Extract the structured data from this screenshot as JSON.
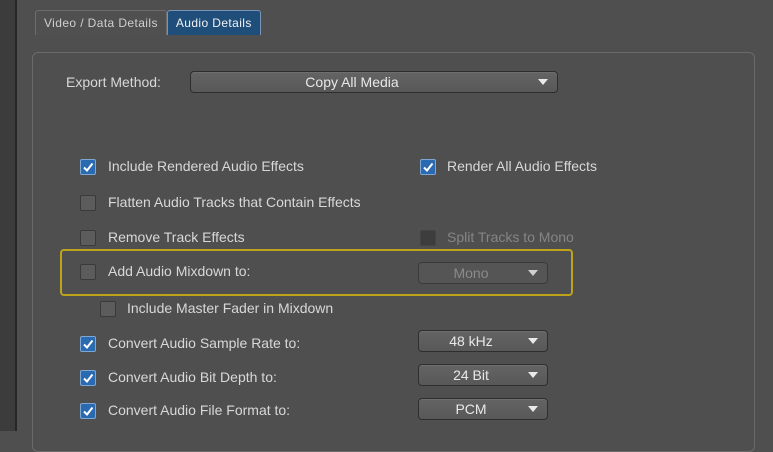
{
  "tabs": [
    {
      "label": "Video / Data Details",
      "active": false
    },
    {
      "label": "Audio Details",
      "active": true
    }
  ],
  "export_method": {
    "label": "Export Method:",
    "value": "Copy All Media"
  },
  "options": {
    "include_rendered_effects": {
      "label": "Include Rendered Audio Effects",
      "checked": true
    },
    "render_all_effects": {
      "label": "Render All Audio Effects",
      "checked": true
    },
    "flatten_tracks": {
      "label": "Flatten Audio Tracks that Contain Effects",
      "checked": false
    },
    "remove_track_effects": {
      "label": "Remove Track Effects",
      "checked": false
    },
    "split_tracks_mono": {
      "label": "Split Tracks to Mono",
      "checked": false,
      "enabled": false
    },
    "add_mixdown": {
      "label": "Add Audio Mixdown to:",
      "checked": false,
      "dropdown_value": "Mono",
      "dropdown_enabled": false
    },
    "include_master_fader": {
      "label": "Include Master Fader in Mixdown",
      "checked": false
    },
    "convert_sample_rate": {
      "label": "Convert Audio Sample Rate to:",
      "checked": true,
      "value": "48 kHz"
    },
    "convert_bit_depth": {
      "label": "Convert Audio Bit Depth to:",
      "checked": true,
      "value": "24 Bit"
    },
    "convert_file_format": {
      "label": "Convert Audio File Format to:",
      "checked": true,
      "value": "PCM"
    }
  },
  "colors": {
    "accent": "#2a6ab0",
    "highlight": "#bfa41b",
    "active_tab": "#1f4e7a",
    "background": "#4f4f4f"
  }
}
